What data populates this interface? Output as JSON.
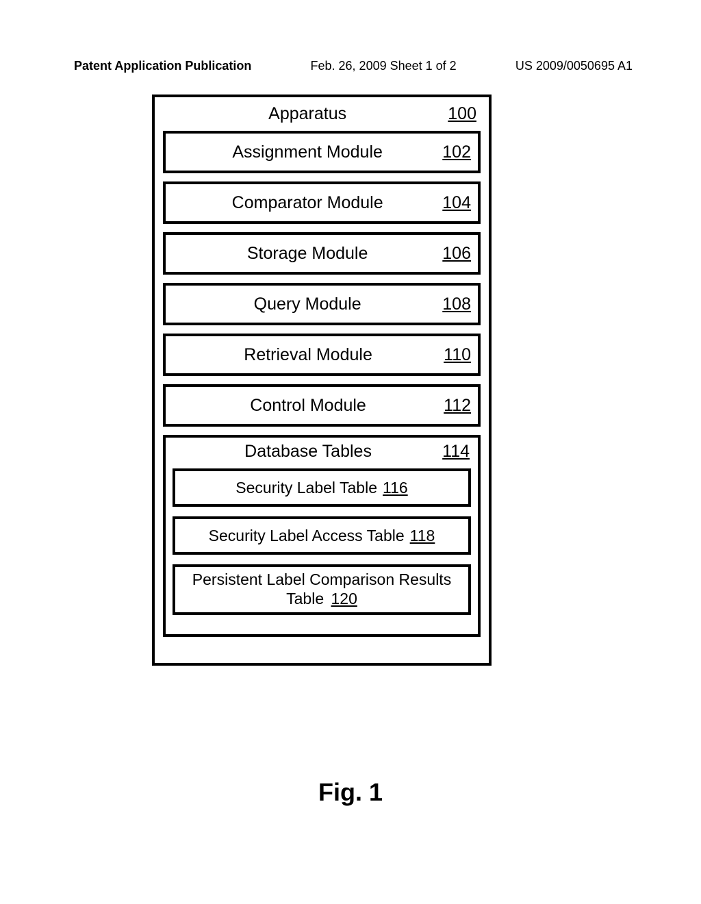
{
  "header": {
    "publication": "Patent Application Publication",
    "date": "Feb. 26, 2009  Sheet 1 of 2",
    "patno": "US 2009/0050695 A1"
  },
  "apparatus": {
    "title": "Apparatus",
    "ref": "100"
  },
  "modules": [
    {
      "title": "Assignment Module",
      "ref": "102"
    },
    {
      "title": "Comparator Module",
      "ref": "104"
    },
    {
      "title": "Storage Module",
      "ref": "106"
    },
    {
      "title": "Query Module",
      "ref": "108"
    },
    {
      "title": "Retrieval Module",
      "ref": "110"
    },
    {
      "title": "Control Module",
      "ref": "112"
    }
  ],
  "db": {
    "title": "Database Tables",
    "ref": "114",
    "tables": [
      {
        "title": "Security Label Table",
        "ref": "116"
      },
      {
        "title": "Security Label Access Table",
        "ref": "118"
      },
      {
        "title_line1": "Persistent Label Comparison Results",
        "title_line2": "Table",
        "ref": "120"
      }
    ]
  },
  "figure_label": "Fig. 1"
}
